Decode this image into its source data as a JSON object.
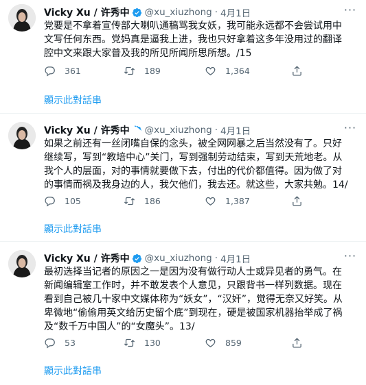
{
  "colors": {
    "accent": "#1d9bf0",
    "muted": "#536471",
    "text": "#0f1419"
  },
  "tweets": [
    {
      "name": "Vicky Xu / 许秀中",
      "handle": "@xu_xiuzhong",
      "sep": "·",
      "date": "4月1日",
      "text": "党要是不拿着宣传部大喇叭通稿骂我女妖，我可能永远都不会尝试用中文写任何东西。党妈真是逼我上进，我也只好拿着这多年没用过的翻译腔中文来跟大家普及我的所见所闻所思所想。/15",
      "replies": "361",
      "retweets": "189",
      "likes": "1,364",
      "thread_link": "顯示此對話串"
    },
    {
      "name": "Vicky Xu / 许秀中",
      "handle": "@xu_xiuzhong",
      "sep": "·",
      "date": "4月1日",
      "text": "如果之前还有一丝闭嘴自保的念头，被全网网暴之后当然没有了。只好继续写，写到“教培中心”关门，写到强制劳动结束，写到天荒地老。从我个人的层面，对的事情就要做下去，付出的代价都值得。因为做了对的事情而祸及我身边的人，我欠他们，我去还。就这些，大家共勉。14/",
      "replies": "105",
      "retweets": "186",
      "likes": "1,387",
      "thread_link": "顯示此對話串"
    },
    {
      "name": "Vicky Xu / 许秀中",
      "handle": "@xu_xiuzhong",
      "sep": "·",
      "date": "4月1日",
      "text": "最初选择当记者的原因之一是因为没有做行动人士或异见者的勇气。在新闻编辑室工作时，并不敢发表个人意见，只跟背书一样列数据。现在看到自己被几十家中文媒体称为“妖女”，“汉奸”，觉得无奈又好笑。从卑微地“偷偷用英文给历史留个底”到现在，硬是被国家机器抬举成了祸及“数千万中国人”的“女魔头”。13/",
      "replies": "53",
      "retweets": "130",
      "likes": "859",
      "thread_link": "顯示此對話串"
    }
  ]
}
